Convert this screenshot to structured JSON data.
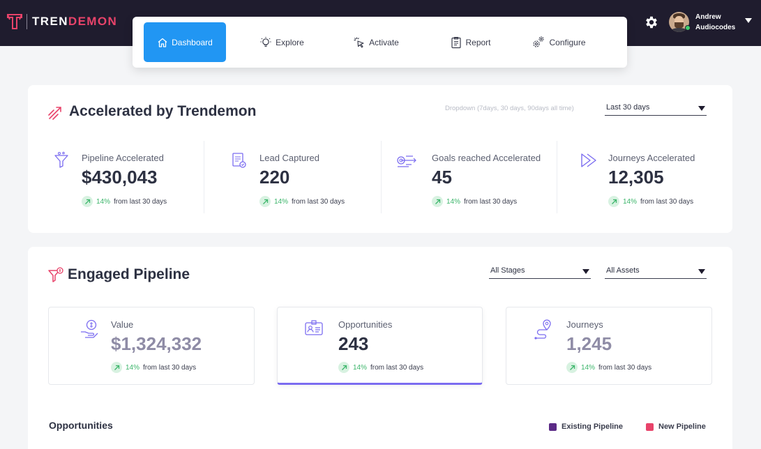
{
  "brand": {
    "name_prefix": "TREN",
    "name_suffix": "DEMON",
    "accent_color": "#e8436a"
  },
  "user": {
    "first_name": "Andrew",
    "company": "Audiocodes"
  },
  "nav": {
    "items": [
      {
        "label": "Dashboard",
        "icon": "home-icon",
        "active": true
      },
      {
        "label": "Explore",
        "icon": "lightbulb-icon"
      },
      {
        "label": "Activate",
        "icon": "cursor-click-icon"
      },
      {
        "label": "Report",
        "icon": "clipboard-icon"
      },
      {
        "label": "Configure",
        "icon": "gears-icon"
      }
    ]
  },
  "accelerated": {
    "title": "Accelerated by Trendemon",
    "dropdown_hint": "Dropdown (7days, 30 days, 90days all time)",
    "period": "Last 30 days",
    "stats": [
      {
        "label": "Pipeline Accelerated",
        "value": "$430,043",
        "trend_pct": "14%",
        "trend_text": "from last 30 days",
        "icon": "funnel-icon"
      },
      {
        "label": "Lead Captured",
        "value": "220",
        "trend_pct": "14%",
        "trend_text": "from last 30 days",
        "icon": "form-check-icon"
      },
      {
        "label": "Goals reached Accelerated",
        "value": "45",
        "trend_pct": "14%",
        "trend_text": "from last 30 days",
        "icon": "target-speed-icon"
      },
      {
        "label": "Journeys Accelerated",
        "value": "12,305",
        "trend_pct": "14%",
        "trend_text": "from last 30 days",
        "icon": "fast-forward-icon"
      }
    ]
  },
  "engaged": {
    "title": "Engaged Pipeline",
    "stages_filter": "All Stages",
    "assets_filter": "All Assets",
    "cards": [
      {
        "label": "Value",
        "value": "$1,324,332",
        "trend_pct": "14%",
        "trend_text": "from last 30 days",
        "icon": "money-hand-icon"
      },
      {
        "label": "Opportunities",
        "value": "243",
        "trend_pct": "14%",
        "trend_text": "from last 30 days",
        "icon": "id-card-icon",
        "selected": true
      },
      {
        "label": "Journeys",
        "value": "1,245",
        "trend_pct": "14%",
        "trend_text": "from last 30 days",
        "icon": "route-pin-icon"
      }
    ],
    "chart_title": "Opportunities",
    "legend": [
      {
        "label": "Existing Pipeline",
        "color": "#5b2a86"
      },
      {
        "label": "New Pipeline",
        "color": "#e8436a"
      }
    ]
  },
  "colors": {
    "topbar": "#1f1c2e",
    "nav_active": "#2196f3",
    "trend_up": "#3bb56a",
    "icon_purple": "#7b6cf0"
  }
}
